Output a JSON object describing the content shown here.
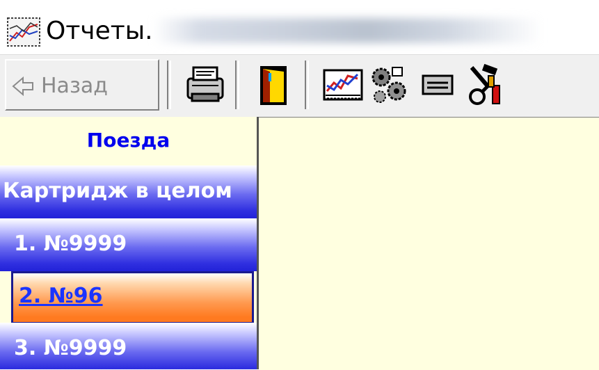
{
  "window": {
    "title": "Отчеты."
  },
  "toolbar": {
    "back_label": "Назад",
    "icons": [
      "print-icon",
      "exit-door-icon",
      "chart-icon",
      "settings-gears-icon",
      "form-icon",
      "tools-icon"
    ]
  },
  "sidebar": {
    "header": "Поезда",
    "items": [
      {
        "label": "Картридж в целом",
        "selected": false
      },
      {
        "label": "1. №9999",
        "selected": false
      },
      {
        "label": "2. №96",
        "selected": true
      },
      {
        "label": "3. №9999",
        "selected": false
      }
    ]
  },
  "colors": {
    "panel_bg": "#ffffe0",
    "header_text": "#0000ee",
    "item_blue": "#3030e0",
    "item_selected": "#ff9a50"
  }
}
